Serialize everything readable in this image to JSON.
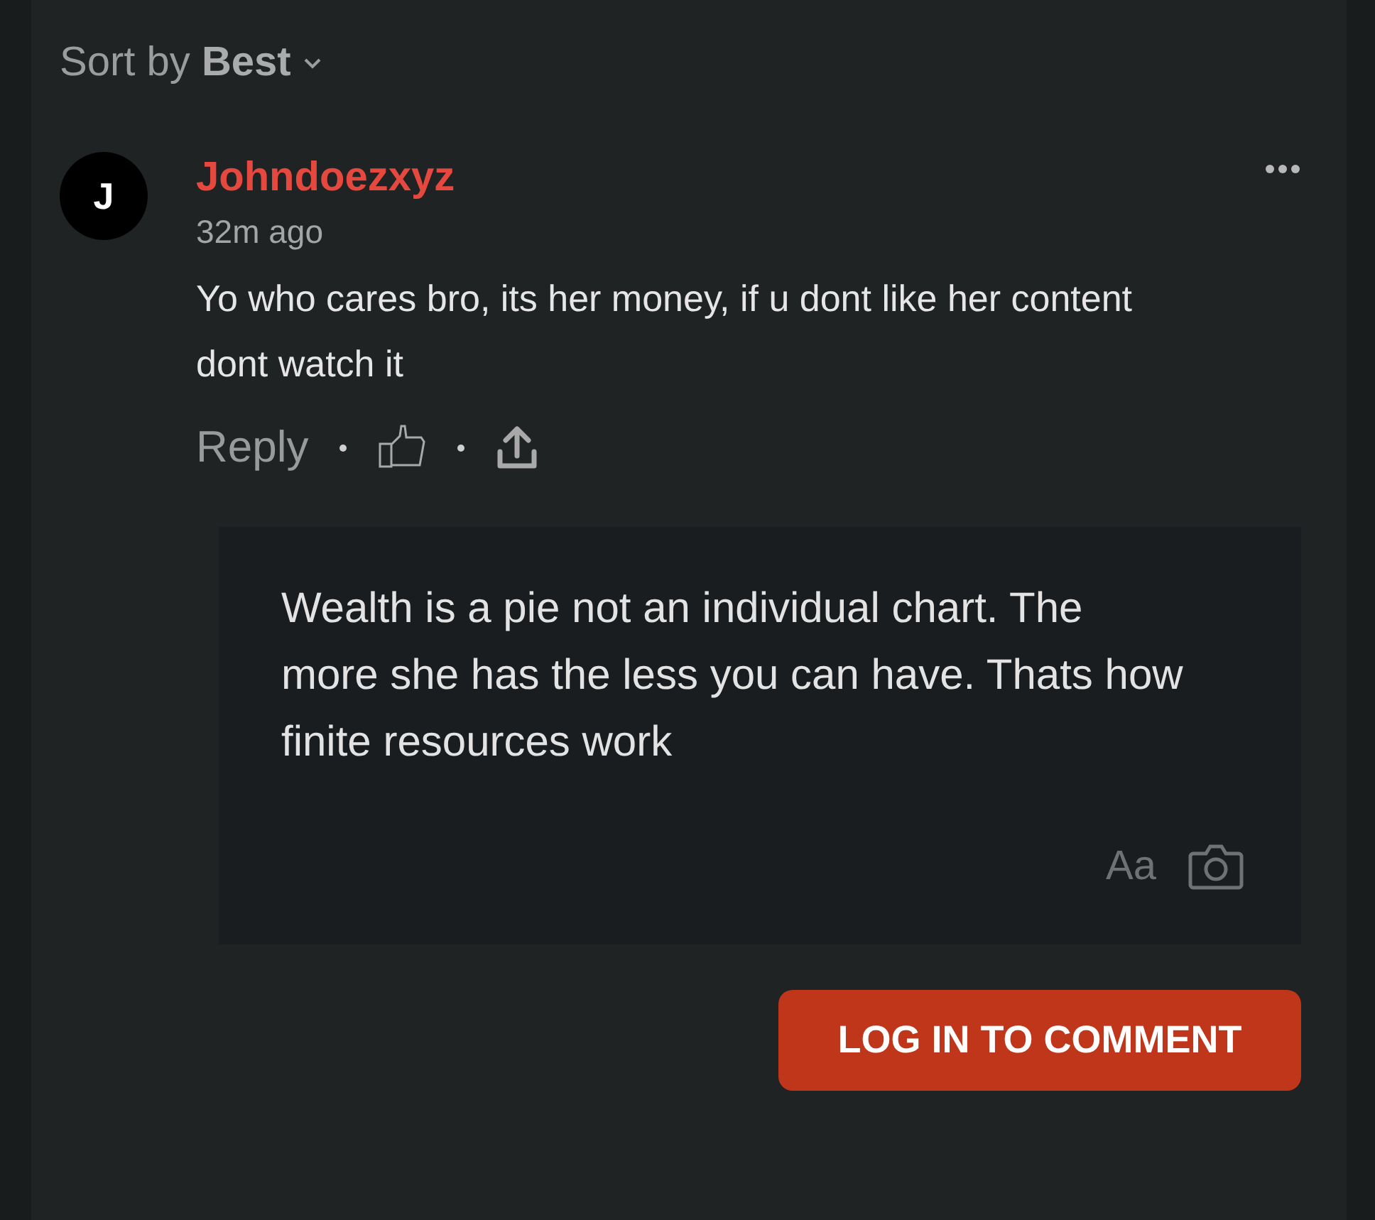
{
  "sort": {
    "label": "Sort by **Best**"
  },
  "comments": [
    {
      "avatar_letter": "J",
      "author": "Johndoezxyz",
      "time": "32m ago",
      "text": "Yo who cares bro, its her money, if u dont like her content dont watch it",
      "reply": "Reply"
    }
  ],
  "composer": {
    "value": "Wealth is a pie not an individual chart. The more she has the less you can have. Thats how finite resources work",
    "format_label": "Aa"
  },
  "login_button": "LOG IN TO COMMENT"
}
